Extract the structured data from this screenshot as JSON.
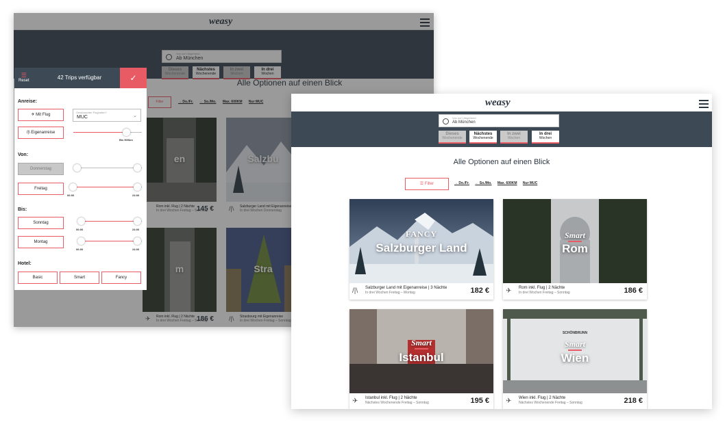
{
  "brand": "weasy",
  "location": {
    "small_label": "Von wo? Abgehend",
    "value": "Ab München"
  },
  "chips": [
    {
      "line1": "Dieses",
      "line2": "Wochenende",
      "state": "off"
    },
    {
      "line1": "Nächstes",
      "line2": "Wochenende",
      "state": "on"
    },
    {
      "line1": "In zwei",
      "line2": "Wochen",
      "state": "off"
    },
    {
      "line1": "In drei",
      "line2": "Wochen",
      "state": "on"
    }
  ],
  "heading": "Alle Optionen auf einen Blick",
  "filter_label": "Filter",
  "meta": [
    "→ Do./Fr.",
    "← So./Mo.",
    "Max. 600KM",
    "Nur MUC"
  ],
  "panel": {
    "reset": "Reset",
    "count": "42 Trips verfügbar",
    "confirm": "✓",
    "anreise": "Anreise:",
    "mit_flug": "Mit Flug",
    "airport_small": "Gewünschter Flughafen?",
    "airport_value": "MUC",
    "eigenanreise": "Eigenanreise",
    "bis_km": "Bis 500km",
    "von": "Von:",
    "donnerstag": "Donnerstag",
    "freitag": "Freitag",
    "bis": "Bis:",
    "sonntag": "Sonntag",
    "montag": "Montag",
    "t_start": "06:00",
    "t_end": "24:00",
    "hotel": "Hotel:",
    "hotel_options": [
      "Basic",
      "Smart",
      "Fancy"
    ]
  },
  "back_cards": [
    {
      "title": "Rom inkl. Flug | 2 Nächte",
      "sub": "In drei Wochen Freitag – Sonntag",
      "price": "145 €",
      "over": "en"
    },
    {
      "title": "Salzburger Land mit Eigenanreise",
      "sub": "In drei Wochen Donnerstag",
      "price": "",
      "over": "Salzbu"
    },
    {
      "title": "Rom inkl. Flug | 2 Nächte",
      "sub": "In drei Wochen Freitag – Sonntag",
      "price": "186 €",
      "over": "m"
    },
    {
      "title": "Strasbourg mit Eigenanreise",
      "sub": "In drei Wochen Freitag – Sonntag",
      "price": "",
      "over": "Stra"
    }
  ],
  "cards": [
    {
      "tag": "FANCY",
      "dest": "Salzburger Land",
      "title": "Salzburger Land mit Eigenanreise | 3 Nächte",
      "sub": "In drei Wochen Freitag – Montag",
      "price": "182 €",
      "icon": "road-icon"
    },
    {
      "tag": "Smart",
      "dest": "Rom",
      "title": "Rom inkl. Flug | 2 Nächte",
      "sub": "In drei Wochen Freitag – Sonntag",
      "price": "186 €",
      "icon": "plane-icon"
    },
    {
      "tag": "Smart",
      "dest": "Istanbul",
      "title": "Istanbul inkl. Flug | 2 Nächte",
      "sub": "Nächstes Wochenende Freitag – Sonntag",
      "price": "195 €",
      "icon": "plane-icon"
    },
    {
      "tag": "Smart",
      "dest": "Wien",
      "title": "Wien inkl. Flug | 2 Nächte",
      "sub": "Nächstes Wochenende Freitag – Sonntag",
      "price": "218 €",
      "icon": "plane-icon",
      "sign": "SCHÖNBRUNN"
    }
  ],
  "colors": {
    "navy": "#3d4a56",
    "accent": "#e85a64",
    "bg": "#ffffff"
  }
}
